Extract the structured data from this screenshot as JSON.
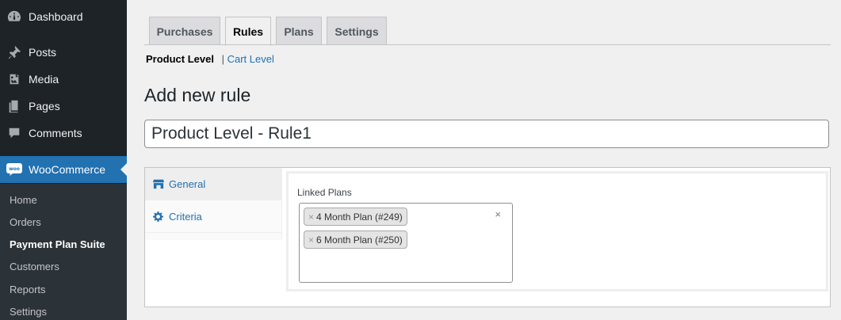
{
  "sidebar": {
    "items": [
      {
        "label": "Dashboard",
        "icon": "dashboard-icon"
      },
      {
        "label": "Posts",
        "icon": "pin-icon"
      },
      {
        "label": "Media",
        "icon": "media-icon"
      },
      {
        "label": "Pages",
        "icon": "pages-icon"
      },
      {
        "label": "Comments",
        "icon": "comment-icon"
      },
      {
        "label": "WooCommerce",
        "icon": "woo-icon"
      }
    ],
    "submenu": [
      "Home",
      "Orders",
      "Payment Plan Suite",
      "Customers",
      "Reports",
      "Settings"
    ]
  },
  "tabs": [
    "Purchases",
    "Rules",
    "Plans",
    "Settings"
  ],
  "subnav": {
    "current": "Product Level",
    "separator": "|",
    "link": "Cart Level"
  },
  "page_title": "Add new rule",
  "rule_name": "Product Level - Rule1",
  "panel": {
    "tabs": [
      "General",
      "Criteria"
    ],
    "linked_plans_label": "Linked Plans",
    "chips": [
      "4 Month Plan (#249)",
      "6 Month Plan (#250)"
    ],
    "chip_remove": "×",
    "clear_all": "×"
  },
  "colors": {
    "accent": "#2271b1",
    "sidebar": "#1d2327",
    "submenu": "#2c3338"
  }
}
